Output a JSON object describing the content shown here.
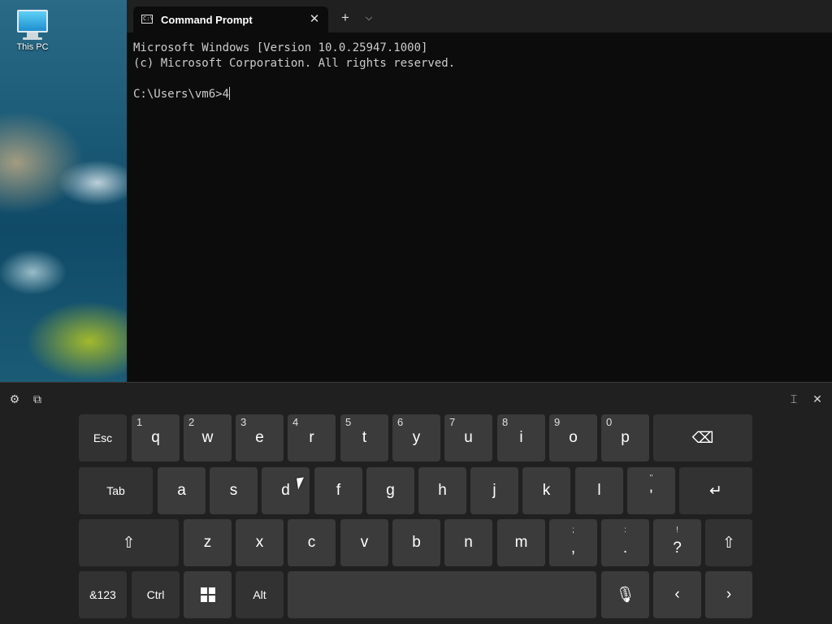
{
  "desktop": {
    "icon_label": "This PC",
    "icon_name": "monitor-icon"
  },
  "terminal": {
    "tab_title": "Command Prompt",
    "tab_icon": "cmd-icon",
    "tab_icon_text": "C:\\",
    "close_glyph": "✕",
    "new_tab_glyph": "+",
    "dropdown_glyph": "⌵",
    "lines": [
      "Microsoft Windows [Version 10.0.25947.1000]",
      "(c) Microsoft Corporation. All rights reserved.",
      "",
      "C:\\Users\\vm6>4"
    ]
  },
  "keyboard": {
    "toolbar": {
      "settings_glyph": "⚙",
      "sticker_glyph": "⧉",
      "dock_glyph": "⌶",
      "close_glyph": "✕"
    },
    "row1": [
      {
        "label": "Esc"
      },
      {
        "label": "q",
        "alt": "1"
      },
      {
        "label": "w",
        "alt": "2"
      },
      {
        "label": "e",
        "alt": "3"
      },
      {
        "label": "r",
        "alt": "4"
      },
      {
        "label": "t",
        "alt": "5"
      },
      {
        "label": "y",
        "alt": "6"
      },
      {
        "label": "u",
        "alt": "7"
      },
      {
        "label": "i",
        "alt": "8"
      },
      {
        "label": "o",
        "alt": "9"
      },
      {
        "label": "p",
        "alt": "0"
      },
      {
        "label": "⌫"
      }
    ],
    "row2": [
      {
        "label": "Tab"
      },
      {
        "label": "a"
      },
      {
        "label": "s"
      },
      {
        "label": "d"
      },
      {
        "label": "f"
      },
      {
        "label": "g"
      },
      {
        "label": "h"
      },
      {
        "label": "j"
      },
      {
        "label": "k"
      },
      {
        "label": "l"
      },
      {
        "label": "'",
        "sym": "\""
      },
      {
        "label": "↵"
      }
    ],
    "row3": [
      {
        "label": "⇧"
      },
      {
        "label": "z"
      },
      {
        "label": "x"
      },
      {
        "label": "c"
      },
      {
        "label": "v"
      },
      {
        "label": "b"
      },
      {
        "label": "n"
      },
      {
        "label": "m"
      },
      {
        "label": ",",
        "sym": ";"
      },
      {
        "label": ".",
        "sym": ":"
      },
      {
        "label": "?",
        "sym": "!"
      },
      {
        "label": "⇧"
      }
    ],
    "row4": [
      {
        "label": "&123"
      },
      {
        "label": "Ctrl"
      },
      {
        "label": "",
        "icon": "windows-logo-icon"
      },
      {
        "label": "Alt"
      },
      {
        "label": ""
      },
      {
        "label": "🎙"
      },
      {
        "label": "‹"
      },
      {
        "label": "›"
      }
    ]
  }
}
